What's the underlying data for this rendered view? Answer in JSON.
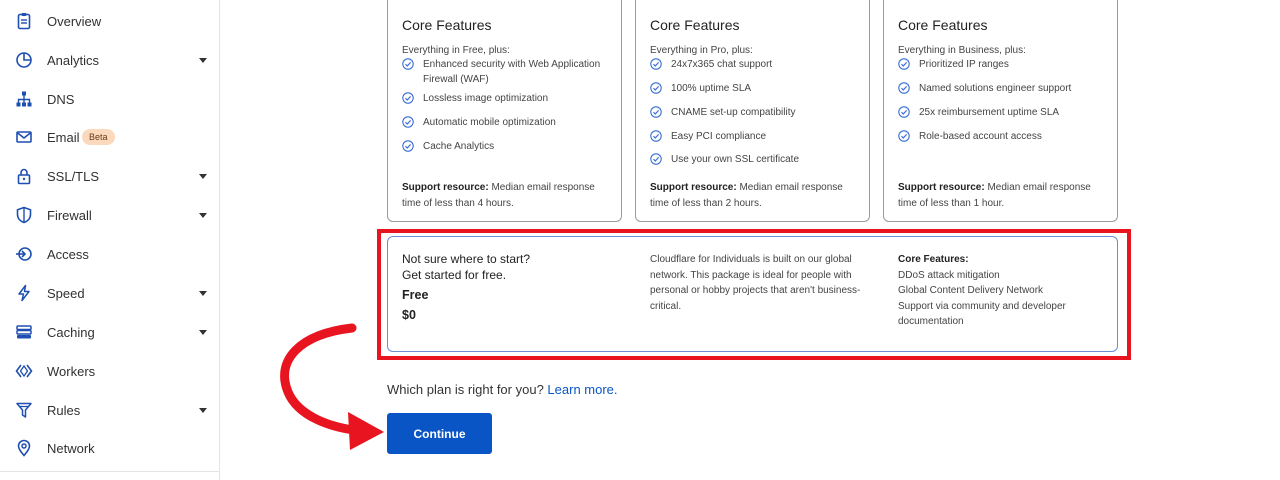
{
  "sidebar": {
    "items": [
      {
        "label": "Overview",
        "icon": "clipboard-icon",
        "caret": false
      },
      {
        "label": "Analytics",
        "icon": "pie-chart-icon",
        "caret": true
      },
      {
        "label": "DNS",
        "icon": "network-tree-icon",
        "caret": false
      },
      {
        "label": "Email",
        "icon": "email-icon",
        "caret": false,
        "badge": "Beta"
      },
      {
        "label": "SSL/TLS",
        "icon": "lock-icon",
        "caret": true
      },
      {
        "label": "Firewall",
        "icon": "shield-icon",
        "caret": true
      },
      {
        "label": "Access",
        "icon": "access-icon",
        "caret": false
      },
      {
        "label": "Speed",
        "icon": "lightning-icon",
        "caret": true
      },
      {
        "label": "Caching",
        "icon": "server-stack-icon",
        "caret": true
      },
      {
        "label": "Workers",
        "icon": "workers-icon",
        "caret": false
      },
      {
        "label": "Rules",
        "icon": "filter-icon",
        "caret": true
      },
      {
        "label": "Network",
        "icon": "location-pin-icon",
        "caret": false
      }
    ]
  },
  "plans": [
    {
      "title": "Core Features",
      "intro": "Everything in Free, plus:",
      "features": [
        "Enhanced security with Web Application Firewall (WAF)",
        "Lossless image optimization",
        "Automatic mobile optimization",
        "Cache Analytics"
      ],
      "support_label": "Support resource:",
      "support_text": "Median email response time of less than 4 hours."
    },
    {
      "title": "Core Features",
      "intro": "Everything in Pro, plus:",
      "features": [
        "24x7x365 chat support",
        "100% uptime SLA",
        "CNAME set-up compatibility",
        "Easy PCI compliance",
        "Use your own SSL certificate"
      ],
      "support_label": "Support resource:",
      "support_text": "Median email response time of less than 2 hours."
    },
    {
      "title": "Core Features",
      "intro": "Everything in Business, plus:",
      "features": [
        "Prioritized IP ranges",
        "Named solutions engineer support",
        "25x reimbursement uptime SLA",
        "Role-based account access"
      ],
      "support_label": "Support resource:",
      "support_text": "Median email response time of less than 1 hour."
    }
  ],
  "free_plan": {
    "question_line1": "Not sure where to start?",
    "question_line2": "Get started for free.",
    "name": "Free",
    "price": "$0",
    "description": "Cloudflare for Individuals is built on our global network. This package is ideal for people with personal or hobby projects that aren't business-critical.",
    "core_label": "Core Features:",
    "core_items": [
      "DDoS attack mitigation",
      "Global Content Delivery Network",
      "Support via community and developer documentation"
    ]
  },
  "help": {
    "text": "Which plan is right for you?",
    "link": "Learn more."
  },
  "continue_label": "Continue",
  "colors": {
    "accent": "#0a55c6",
    "highlight": "#e8141f",
    "check": "#3b6fd4"
  }
}
